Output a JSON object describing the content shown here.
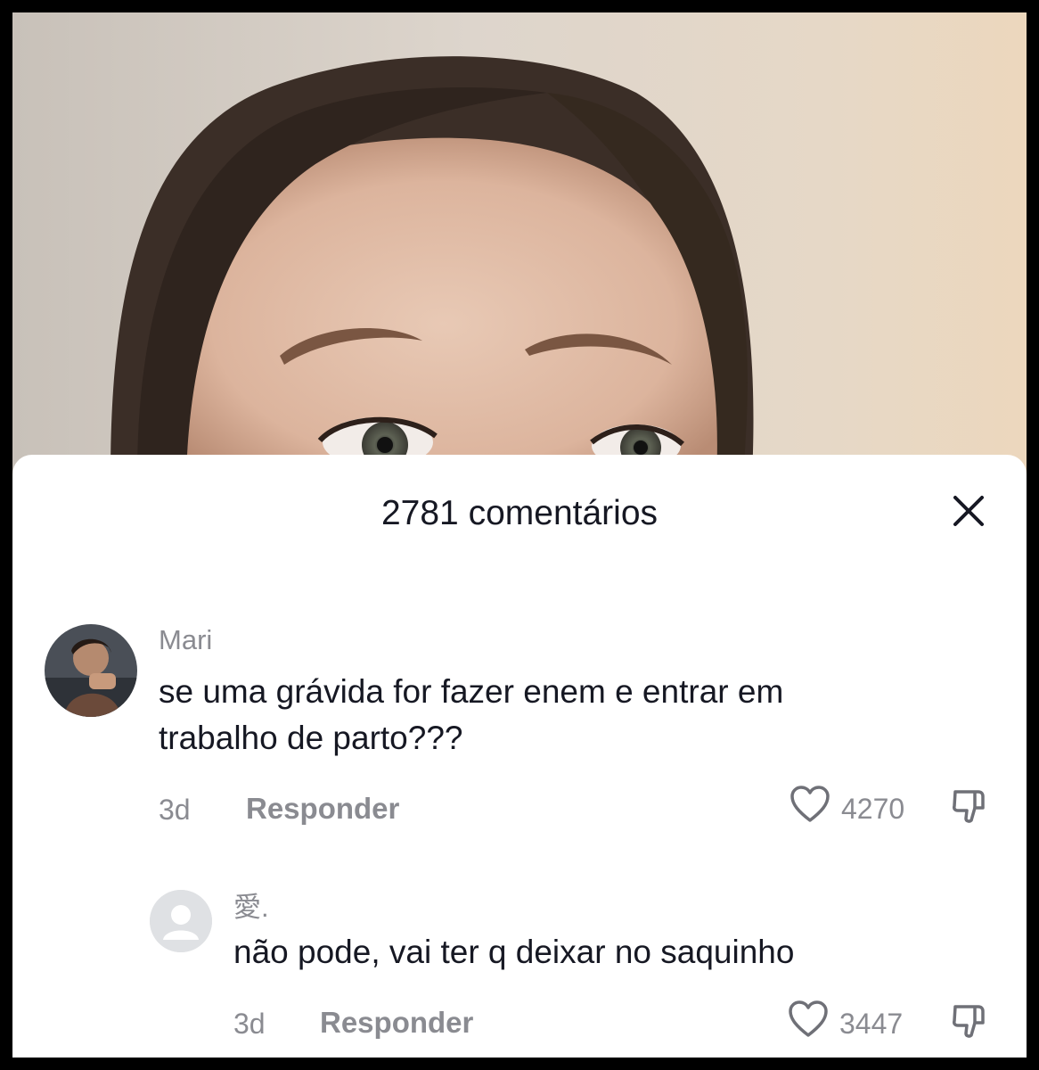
{
  "panel": {
    "title": "2781 comentários",
    "close_icon": "close-icon"
  },
  "comments": [
    {
      "username": "Mari",
      "text_line1": "se uma grávida for fazer enem e entrar em",
      "text_line2": "trabalho de parto???",
      "time": "3d",
      "reply_label": "Responder",
      "likes": "4270"
    },
    {
      "username": "愛.",
      "text_line1": "não pode, vai ter q deixar no saquinho",
      "time": "3d",
      "reply_label": "Responder",
      "likes": "3447"
    }
  ],
  "colors": {
    "text_primary": "#161823",
    "text_secondary": "#8a8b91",
    "sheet_bg": "#ffffff"
  }
}
